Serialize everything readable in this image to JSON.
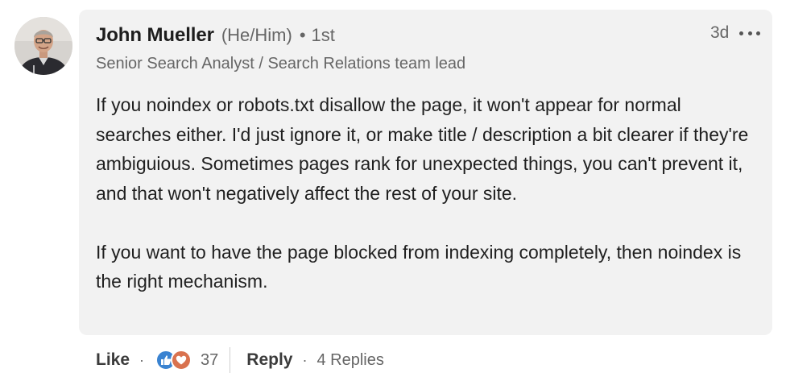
{
  "author": {
    "name": "John Mueller",
    "pronouns": "(He/Him)",
    "separator": "•",
    "connection_degree": "1st",
    "headline": "Senior Search Analyst / Search Relations team lead"
  },
  "meta": {
    "timestamp": "3d",
    "more_icon": "more-horizontal-icon"
  },
  "comment": {
    "paragraphs": [
      "If you noindex or robots.txt disallow the page, it won't appear for normal searches either. I'd just ignore it, or make title / description a bit clearer if they're ambiguious. Sometimes pages rank for unexpected things, you can't prevent it, and that won't negatively affect the rest of your site.",
      "If you want to have the page blocked from indexing completely, then noindex is the right mechanism."
    ]
  },
  "actions": {
    "like_label": "Like",
    "dot": "·",
    "reaction_icons": [
      "like-reaction-icon",
      "love-reaction-icon"
    ],
    "reaction_count": "37",
    "reply_label": "Reply",
    "replies_label": "4 Replies"
  },
  "colors": {
    "bubble_background": "#f2f2f2",
    "like_reaction": "#3a83d1",
    "love_reaction": "#d9724f",
    "secondary_text": "#666666"
  }
}
